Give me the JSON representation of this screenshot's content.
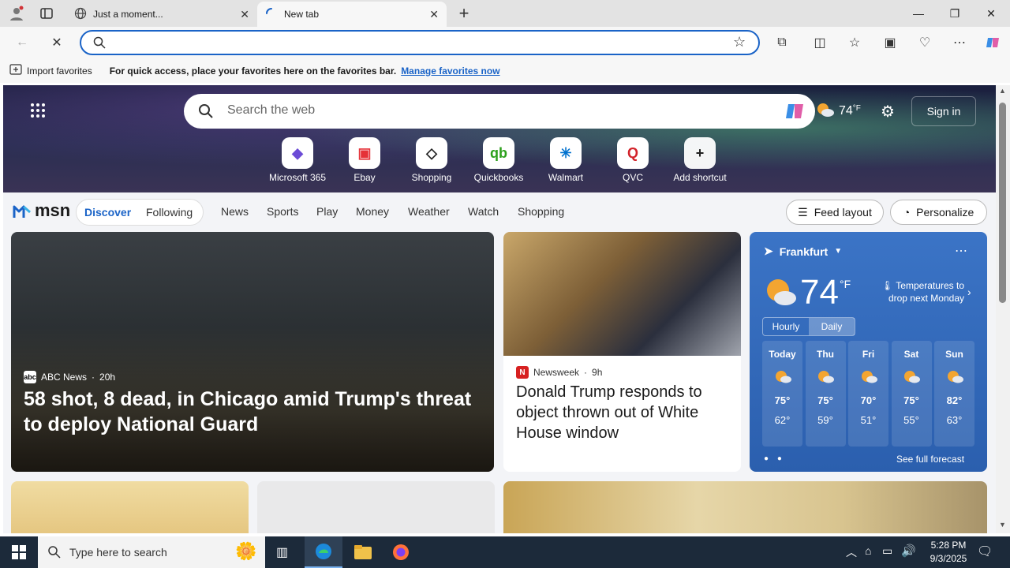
{
  "browser": {
    "tabs": [
      {
        "title": "Just a moment..."
      },
      {
        "title": "New tab"
      }
    ],
    "new_tab_symbol": "+",
    "window_controls": {
      "minimize": "—",
      "restore": "❐",
      "close": "✕"
    },
    "address_value": "",
    "favorites_bar": {
      "import_label": "Import favorites",
      "hint": "For quick access, place your favorites here on the favorites bar.",
      "manage_link": "Manage favorites now"
    }
  },
  "msn": {
    "search_placeholder": "Search the web",
    "weather_temp": "74",
    "weather_unit": "°F",
    "sign_in": "Sign in",
    "shortcuts": [
      {
        "label": "Microsoft 365",
        "icon": "microsoft365-icon",
        "glyph": "◆",
        "color": "#6b4bd6"
      },
      {
        "label": "Ebay",
        "icon": "ebay-icon",
        "glyph": "▣",
        "color": "#e53238"
      },
      {
        "label": "Shopping",
        "icon": "shopping-tag-icon",
        "glyph": "◇",
        "color": "#222222"
      },
      {
        "label": "Quickbooks",
        "icon": "quickbooks-icon",
        "glyph": "qb",
        "color": "#2ca01c"
      },
      {
        "label": "Walmart",
        "icon": "walmart-icon",
        "glyph": "✳",
        "color": "#0071ce"
      },
      {
        "label": "QVC",
        "icon": "qvc-icon",
        "glyph": "Q",
        "color": "#d2232a"
      },
      {
        "label": "Add shortcut",
        "icon": "plus-icon",
        "glyph": "+",
        "color": "#ffffff"
      }
    ],
    "logo": "msn",
    "tabs": {
      "discover": "Discover",
      "following": "Following"
    },
    "nav_links": [
      "News",
      "Sports",
      "Play",
      "Money",
      "Weather",
      "Watch",
      "Shopping"
    ],
    "feed_layout": "Feed layout",
    "personalize": "Personalize",
    "hero_story": {
      "source": "ABC News",
      "age": "20h",
      "headline": "58 shot, 8 dead, in Chicago amid Trump's threat to deploy National Guard"
    },
    "side_story": {
      "source": "Newsweek",
      "age": "9h",
      "headline": "Donald Trump responds to object thrown out of White House window"
    },
    "weather_card": {
      "city": "Frankfurt",
      "temp": "74",
      "unit": "°F",
      "alert": "Temperatures to drop next Monday",
      "toggle": {
        "hourly": "Hourly",
        "daily": "Daily"
      },
      "days": [
        {
          "day": "Today",
          "high": "75°",
          "low": "62°"
        },
        {
          "day": "Thu",
          "high": "75°",
          "low": "59°"
        },
        {
          "day": "Fri",
          "high": "70°",
          "low": "51°"
        },
        {
          "day": "Sat",
          "high": "75°",
          "low": "55°"
        },
        {
          "day": "Sun",
          "high": "82°",
          "low": "63°"
        }
      ],
      "full_forecast": "See full forecast"
    }
  },
  "taskbar": {
    "search_placeholder": "Type here to search",
    "time": "5:28 PM",
    "date": "9/3/2025"
  },
  "colors": {
    "accent": "#1a63c7",
    "taskbar": "#1c2a3a",
    "weather_card": "#2b5fae"
  }
}
